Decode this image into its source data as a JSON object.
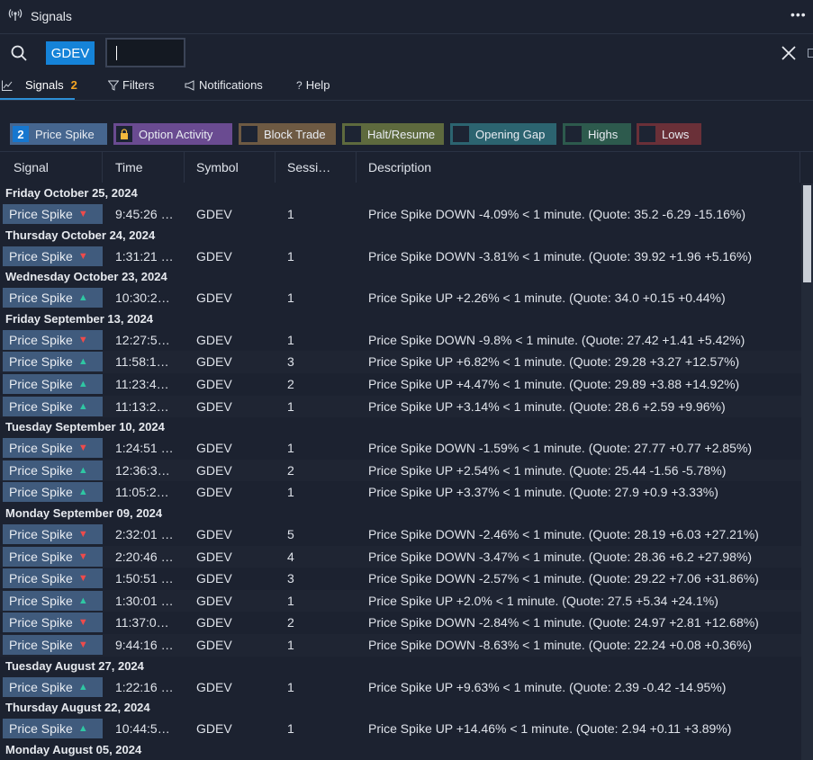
{
  "window": {
    "title": "Signals",
    "more_label": "•••"
  },
  "search": {
    "symbol": "GDEV",
    "input_value": ""
  },
  "tabs": [
    {
      "label": "Signals",
      "count": "2"
    },
    {
      "label": "Filters"
    },
    {
      "label": "Notifications"
    },
    {
      "label": "Help"
    }
  ],
  "chips": {
    "price_spike": {
      "count": "2",
      "label": "Price Spike"
    },
    "option_activity": {
      "label": "Option Activity"
    },
    "block_trade": {
      "label": "Block Trade"
    },
    "halt_resume": {
      "label": "Halt/Resume"
    },
    "opening_gap": {
      "label": "Opening Gap"
    },
    "highs": {
      "label": "Highs"
    },
    "lows": {
      "label": "Lows"
    }
  },
  "columns": {
    "signal": "Signal",
    "time": "Time",
    "symbol": "Symbol",
    "session": "Sessi…",
    "description": "Description"
  },
  "groups": [
    {
      "date": "Friday October 25, 2024",
      "rows": [
        {
          "signal": "Price Spike",
          "dir": "down",
          "time": "9:45:26 …",
          "symbol": "GDEV",
          "session": "1",
          "description": "Price Spike DOWN -4.09% < 1 minute. (Quote: 35.2 -6.29 -15.16%)"
        }
      ]
    },
    {
      "date": "Thursday October 24, 2024",
      "rows": [
        {
          "signal": "Price Spike",
          "dir": "down",
          "time": "1:31:21 …",
          "symbol": "GDEV",
          "session": "1",
          "description": "Price Spike DOWN -3.81% < 1 minute. (Quote: 39.92 +1.96 +5.16%)"
        }
      ]
    },
    {
      "date": "Wednesday October 23, 2024",
      "rows": [
        {
          "signal": "Price Spike",
          "dir": "up",
          "time": "10:30:2…",
          "symbol": "GDEV",
          "session": "1",
          "description": "Price Spike UP +2.26% < 1 minute. (Quote: 34.0 +0.15 +0.44%)"
        }
      ]
    },
    {
      "date": "Friday September 13, 2024",
      "rows": [
        {
          "signal": "Price Spike",
          "dir": "down",
          "time": "12:27:5…",
          "symbol": "GDEV",
          "session": "1",
          "description": "Price Spike DOWN -9.8% < 1 minute. (Quote: 27.42 +1.41 +5.42%)"
        },
        {
          "signal": "Price Spike",
          "dir": "up",
          "time": "11:58:1…",
          "symbol": "GDEV",
          "session": "3",
          "description": "Price Spike UP +6.82% < 1 minute. (Quote: 29.28 +3.27 +12.57%)"
        },
        {
          "signal": "Price Spike",
          "dir": "up",
          "time": "11:23:4…",
          "symbol": "GDEV",
          "session": "2",
          "description": "Price Spike UP +4.47% < 1 minute. (Quote: 29.89 +3.88 +14.92%)"
        },
        {
          "signal": "Price Spike",
          "dir": "up",
          "time": "11:13:2…",
          "symbol": "GDEV",
          "session": "1",
          "description": "Price Spike UP +3.14% < 1 minute. (Quote: 28.6 +2.59 +9.96%)"
        }
      ]
    },
    {
      "date": "Tuesday September 10, 2024",
      "rows": [
        {
          "signal": "Price Spike",
          "dir": "down",
          "time": "1:24:51 …",
          "symbol": "GDEV",
          "session": "1",
          "description": "Price Spike DOWN -1.59% < 1 minute. (Quote: 27.77 +0.77 +2.85%)"
        },
        {
          "signal": "Price Spike",
          "dir": "up",
          "time": "12:36:3…",
          "symbol": "GDEV",
          "session": "2",
          "description": "Price Spike UP +2.54% < 1 minute. (Quote: 25.44 -1.56 -5.78%)"
        },
        {
          "signal": "Price Spike",
          "dir": "up",
          "time": "11:05:2…",
          "symbol": "GDEV",
          "session": "1",
          "description": "Price Spike UP +3.37% < 1 minute. (Quote: 27.9 +0.9 +3.33%)"
        }
      ]
    },
    {
      "date": "Monday September 09, 2024",
      "rows": [
        {
          "signal": "Price Spike",
          "dir": "down",
          "time": "2:32:01 …",
          "symbol": "GDEV",
          "session": "5",
          "description": "Price Spike DOWN -2.46% < 1 minute. (Quote: 28.19 +6.03 +27.21%)"
        },
        {
          "signal": "Price Spike",
          "dir": "down",
          "time": "2:20:46 …",
          "symbol": "GDEV",
          "session": "4",
          "description": "Price Spike DOWN -3.47% < 1 minute. (Quote: 28.36 +6.2 +27.98%)"
        },
        {
          "signal": "Price Spike",
          "dir": "down",
          "time": "1:50:51 …",
          "symbol": "GDEV",
          "session": "3",
          "description": "Price Spike DOWN -2.57% < 1 minute. (Quote: 29.22 +7.06 +31.86%)"
        },
        {
          "signal": "Price Spike",
          "dir": "up",
          "time": "1:30:01 …",
          "symbol": "GDEV",
          "session": "1",
          "description": "Price Spike UP +2.0% < 1 minute. (Quote: 27.5 +5.34 +24.1%)"
        },
        {
          "signal": "Price Spike",
          "dir": "down",
          "time": "11:37:0…",
          "symbol": "GDEV",
          "session": "2",
          "description": "Price Spike DOWN -2.84% < 1 minute. (Quote: 24.97 +2.81 +12.68%)"
        },
        {
          "signal": "Price Spike",
          "dir": "down",
          "time": "9:44:16 …",
          "symbol": "GDEV",
          "session": "1",
          "description": "Price Spike DOWN -8.63% < 1 minute. (Quote: 22.24 +0.08 +0.36%)"
        }
      ]
    },
    {
      "date": "Tuesday August 27, 2024",
      "rows": [
        {
          "signal": "Price Spike",
          "dir": "up",
          "time": "1:22:16 …",
          "symbol": "GDEV",
          "session": "1",
          "description": "Price Spike UP +9.63% < 1 minute. (Quote: 2.39 -0.42 -14.95%)"
        }
      ]
    },
    {
      "date": "Thursday August 22, 2024",
      "rows": [
        {
          "signal": "Price Spike",
          "dir": "up",
          "time": "10:44:5…",
          "symbol": "GDEV",
          "session": "1",
          "description": "Price Spike UP +14.46% < 1 minute. (Quote: 2.94 +0.11 +3.89%)"
        }
      ]
    },
    {
      "date": "Monday August 05, 2024",
      "rows": []
    }
  ],
  "colors": {
    "background": "#1c2230",
    "accent": "#1583d8",
    "tab_count": "#f5a623",
    "arrow_down": "#ef4b4b",
    "arrow_up": "#2fc7a3",
    "signal_cell": "#405b7d"
  }
}
